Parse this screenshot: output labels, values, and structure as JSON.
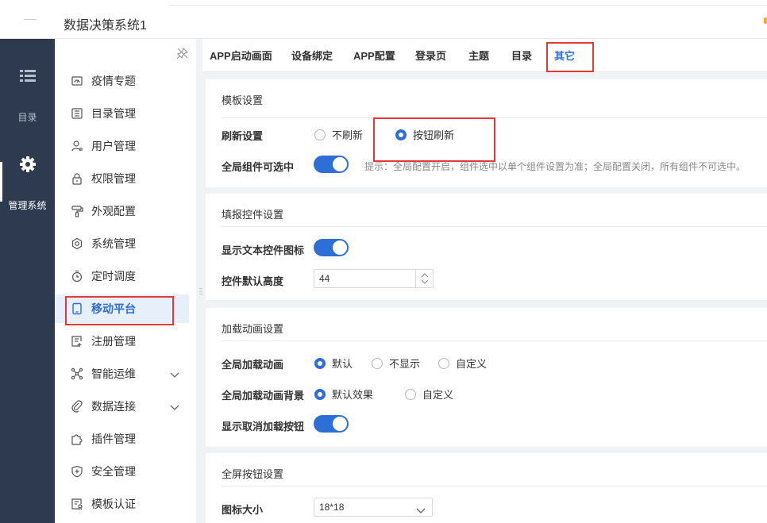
{
  "header": {
    "title": "数据决策系统1"
  },
  "rail": {
    "items": [
      {
        "label": "目录",
        "icon": "list-icon"
      },
      {
        "label": "管理系统",
        "icon": "gear-icon"
      }
    ]
  },
  "menu": {
    "items": [
      {
        "label": "疫情专题",
        "icon": "dashboard-icon"
      },
      {
        "label": "目录管理",
        "icon": "catalog-icon"
      },
      {
        "label": "用户管理",
        "icon": "user-icon"
      },
      {
        "label": "权限管理",
        "icon": "lock-icon"
      },
      {
        "label": "外观配置",
        "icon": "paint-roller-icon"
      },
      {
        "label": "系统管理",
        "icon": "settings-icon"
      },
      {
        "label": "定时调度",
        "icon": "timer-icon"
      },
      {
        "label": "移动平台",
        "icon": "mobile-icon"
      },
      {
        "label": "注册管理",
        "icon": "register-icon"
      },
      {
        "label": "智能运维",
        "icon": "network-icon"
      },
      {
        "label": "数据连接",
        "icon": "link-icon"
      },
      {
        "label": "插件管理",
        "icon": "puzzle-icon"
      },
      {
        "label": "安全管理",
        "icon": "shield-icon"
      },
      {
        "label": "模板认证",
        "icon": "certificate-icon"
      }
    ]
  },
  "tabs": [
    "APP启动画面",
    "设备绑定",
    "APP配置",
    "登录页",
    "主题",
    "目录",
    "其它"
  ],
  "template": {
    "title": "模板设置",
    "refresh_label": "刷新设置",
    "refresh_options": [
      "不刷新",
      "按钮刷新"
    ],
    "global_select_label": "全局组件可选中",
    "global_select_hint": "提示：全局配置开启，组件选中以单个组件设置为准；全局配置关闭，所有组件不可选中。"
  },
  "fill": {
    "title": "填报控件设置",
    "show_icon_label": "显示文本控件图标",
    "height_label": "控件默认高度",
    "height_value": "44"
  },
  "loading": {
    "title": "加载动画设置",
    "global_anim_label": "全局加载动画",
    "global_anim_options": [
      "默认",
      "不显示",
      "自定义"
    ],
    "bg_label": "全局加载动画背景",
    "bg_options": [
      "默认效果",
      "自定义"
    ],
    "cancel_label": "显示取消加载按钮"
  },
  "fullscreen": {
    "title": "全屏按钮设置",
    "icon_size_label": "图标大小",
    "icon_size_value": "18*18"
  },
  "colors": {
    "accent": "#2d6fd6",
    "rail": "#2d3a4f",
    "highlight": "#e53935"
  }
}
